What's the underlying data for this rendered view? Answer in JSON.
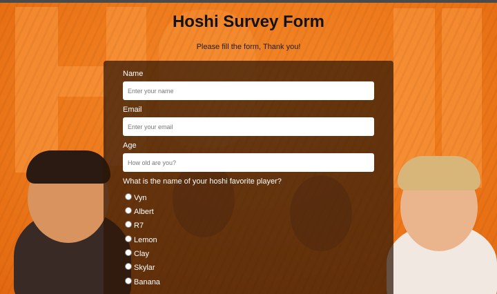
{
  "page": {
    "title": "Hoshi Survey Form",
    "subtitle": "Please fill the form, Thank you!"
  },
  "form": {
    "name": {
      "label": "Name",
      "placeholder": "Enter your name"
    },
    "email": {
      "label": "Email",
      "placeholder": "Enter your email"
    },
    "age": {
      "label": "Age",
      "placeholder": "How old are you?"
    },
    "favorite_player": {
      "question": "What is the name of your hoshi favorite player?",
      "options": [
        "Vyn",
        "Albert",
        "R7",
        "Lemon",
        "Clay",
        "Skylar",
        "Banana"
      ]
    }
  },
  "colors": {
    "background_orange": "#f07a1e",
    "card_overlay": "rgba(46, 22, 6, 0.72)",
    "title_text": "#121212",
    "label_text": "#ffffff"
  }
}
